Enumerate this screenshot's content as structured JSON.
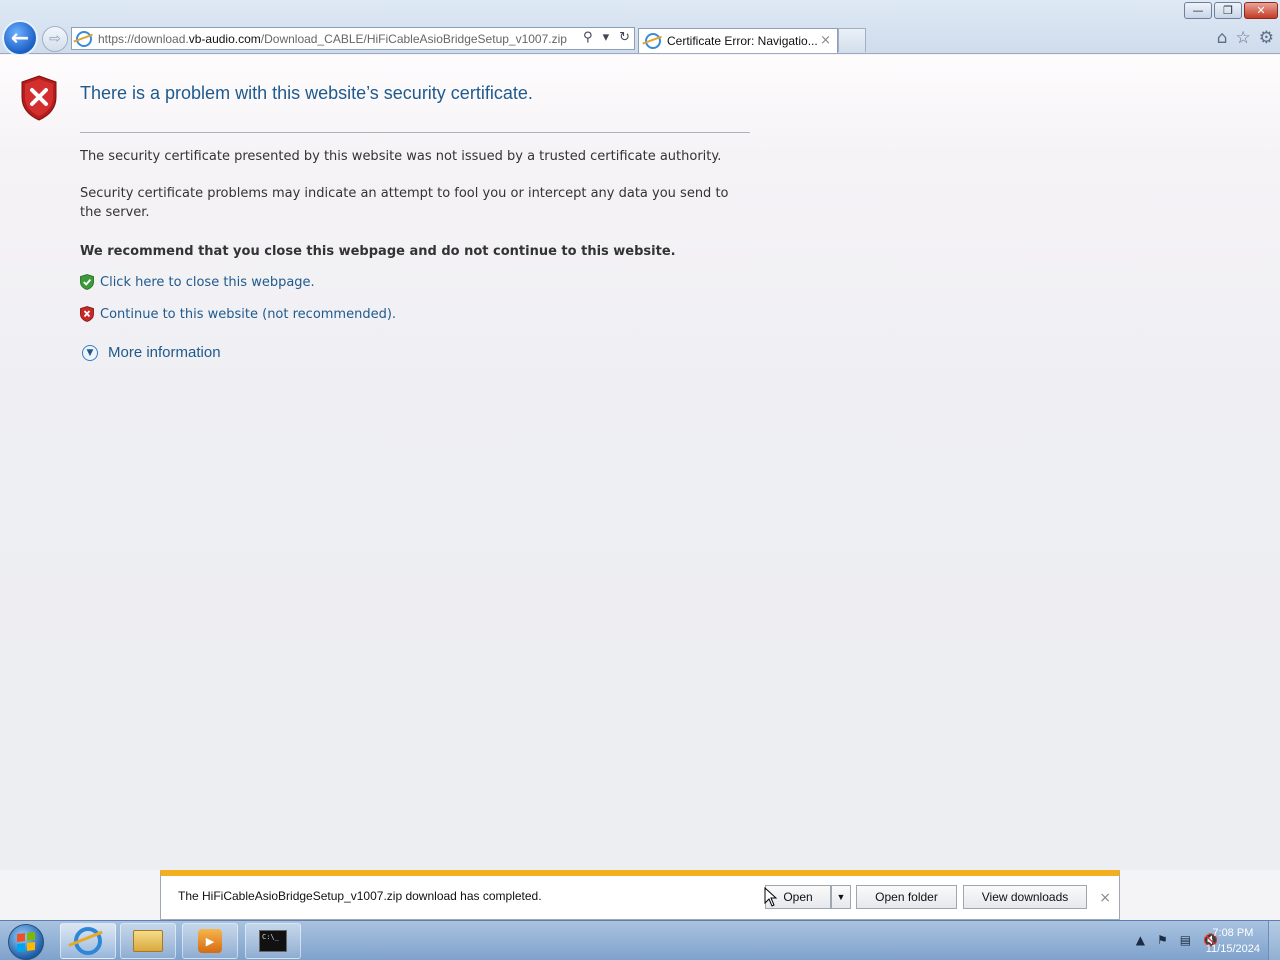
{
  "window": {
    "minimize": "—",
    "restore": "❐",
    "close": "✕"
  },
  "address_bar": {
    "url_prefix": "https://download.",
    "url_domain": "vb-audio.com",
    "url_path": "/Download_CABLE/HiFiCableAsioBridgeSetup_v1007.zip"
  },
  "tab": {
    "title": "Certificate Error: Navigatio...",
    "close": "×"
  },
  "page": {
    "title": "There is a problem with this website’s security certificate.",
    "paragraph1": "The security certificate presented by this website was not issued by a trusted certificate authority.",
    "paragraph2": "Security certificate problems may indicate an attempt to fool you or intercept any data you send to the server.",
    "recommendation": "We recommend that you close this webpage and do not continue to this website.",
    "close_link": "Click here to close this webpage.",
    "continue_link": "Continue to this website (not recommended).",
    "more_info": "More information"
  },
  "download_bar": {
    "message": "The HiFiCableAsioBridgeSetup_v1007.zip download has completed.",
    "open_label": "Open",
    "open_folder_label": "Open folder",
    "view_downloads_label": "View downloads",
    "close": "×"
  },
  "taskbar": {
    "time": "7:08 PM",
    "date": "11/15/2024",
    "cmd_text": "C:\\_"
  },
  "icons": {
    "back": "back-arrow-icon",
    "forward": "forward-arrow-icon",
    "home": "home-icon",
    "favorites": "star-icon",
    "tools": "gear-icon"
  },
  "colors": {
    "link": "#1f5a8d",
    "download_accent": "#f2b01e",
    "error_red": "#c62828",
    "safe_green": "#3a9a3a"
  }
}
